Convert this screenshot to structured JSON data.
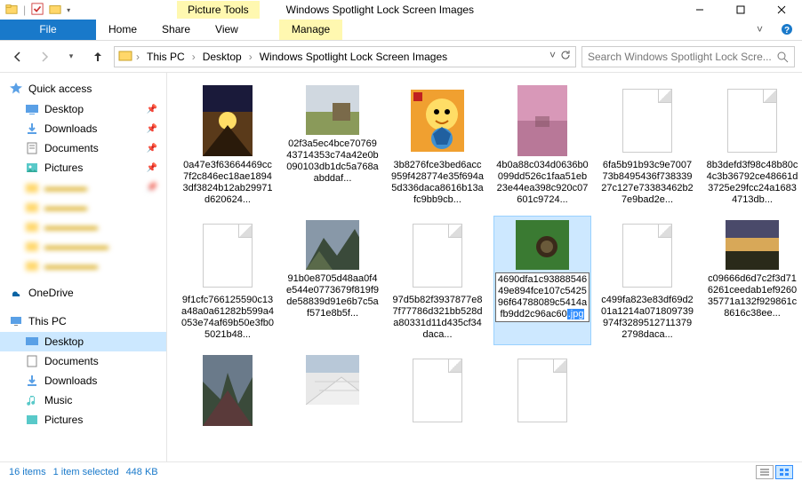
{
  "window": {
    "title": "Windows Spotlight Lock Screen Images",
    "tools_label": "Picture Tools"
  },
  "ribbon": {
    "file": "File",
    "home": "Home",
    "share": "Share",
    "view": "View",
    "manage": "Manage"
  },
  "breadcrumb": {
    "root": "This PC",
    "mid": "Desktop",
    "leaf": "Windows Spotlight Lock Screen Images"
  },
  "search": {
    "placeholder": "Search Windows Spotlight Lock Scre..."
  },
  "sidebar": {
    "quick": "Quick access",
    "desktop": "Desktop",
    "downloads": "Downloads",
    "documents": "Documents",
    "pictures": "Pictures",
    "blur1": "▬▬▬▬",
    "blur2": "▬▬▬▬",
    "blur3": "▬▬▬▬▬",
    "blur4": "▬▬▬▬▬▬",
    "blur5": "▬▬▬▬▬",
    "onedrive": "OneDrive",
    "thispc": "This PC",
    "desktop2": "Desktop",
    "documents2": "Documents",
    "downloads2": "Downloads",
    "music": "Music",
    "pictures2": "Pictures"
  },
  "files": [
    {
      "name": "0a47e3f63664469cc7f2c846ec18ae18943df3824b12ab29971d620624...",
      "thumb": "sunset1"
    },
    {
      "name": "02f3a5ec4bce7076943714353c74a42e0b090103db1dc5a768aabddaf...",
      "thumb": "field"
    },
    {
      "name": "3b8276fce3bed6acc959f428774e35f694a5d336daca8616b13afc9bb9cb...",
      "thumb": "game"
    },
    {
      "name": "4b0a88c034d0636b0099dd526c1faa51eb23e44ea398c920c07601c9724...",
      "thumb": "pink"
    },
    {
      "name": "6fa5b91b93c9e700773b8495436f73833927c127e73383462b27e9bad2e...",
      "thumb": "blank"
    },
    {
      "name": "8b3defd3f98c48b80c4c3b36792ce48661d3725e29fcc24a16834713db...",
      "thumb": "blank"
    },
    {
      "name": "9f1cfc766125590c13a48a0a61282b599a4053e74af69b50e3fb05021b48...",
      "thumb": "blank"
    },
    {
      "name": "91b0e8705d48aa0f4e544e0773679f819f9de58839d91e6b7c5af571e8b5f...",
      "thumb": "mountain"
    },
    {
      "name": "97d5b82f3937877e87f77786d321bb528da80331d11d435cf34daca...",
      "thumb": "blank"
    },
    {
      "name": "4690dfa1c9388854649e894fce107c542596f64788089c5414afb9dd2c96ac60",
      "ext": ".jpg",
      "thumb": "green",
      "selected": true
    },
    {
      "name": "c499fa823e83df69d201a1214a071809739974f32895127113792798daca...",
      "thumb": "blank"
    },
    {
      "name": "c09666d6d7c2f3d716261ceedab1ef926035771a132f929861c8616c38ee...",
      "thumb": "sunset2"
    },
    {
      "name": "",
      "thumb": "valley"
    },
    {
      "name": "",
      "thumb": "salt"
    },
    {
      "name": "",
      "thumb": "blank"
    },
    {
      "name": "",
      "thumb": "blank"
    }
  ],
  "status": {
    "count": "16 items",
    "selection": "1 item selected",
    "size": "448 KB"
  }
}
